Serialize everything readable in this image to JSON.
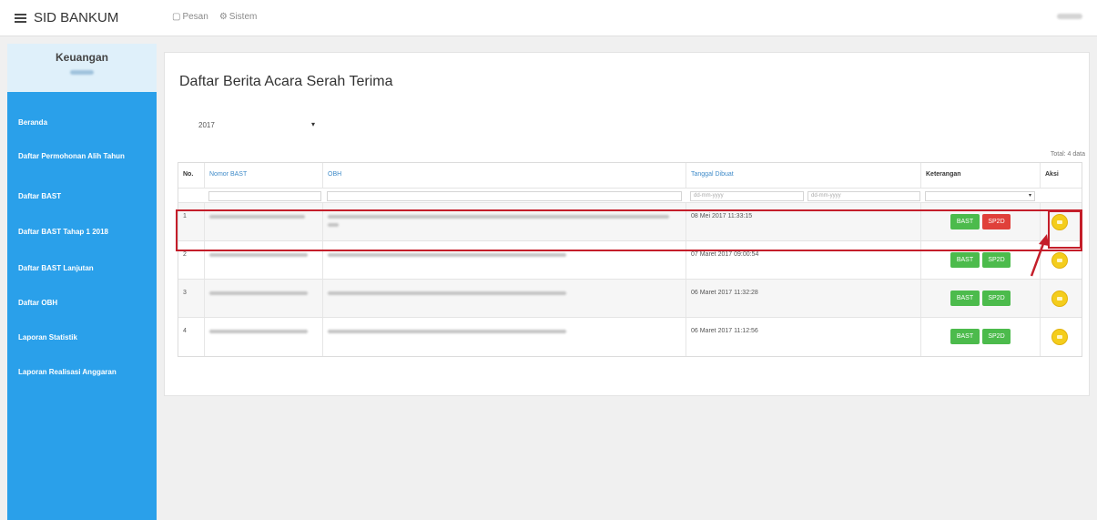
{
  "app": {
    "brand": "SID BANKUM"
  },
  "topnav": {
    "items": [
      {
        "icon": "message-icon",
        "label": "Pesan"
      },
      {
        "icon": "gear-icon",
        "label": "Sistem"
      }
    ]
  },
  "sidebar": {
    "header": {
      "title": "Keuangan"
    },
    "items": [
      {
        "label": "Beranda"
      },
      {
        "label": "Daftar Permohonan Alih Tahun"
      },
      {
        "label": "Daftar BAST"
      },
      {
        "label": "Daftar BAST Tahap 1 2018"
      },
      {
        "label": "Daftar BAST Lanjutan"
      },
      {
        "label": "Daftar OBH"
      },
      {
        "label": "Laporan Statistik"
      },
      {
        "label": "Laporan Realisasi Anggaran"
      }
    ]
  },
  "main": {
    "title": "Daftar Berita Acara Serah Terima",
    "year_select": {
      "value": "2017"
    },
    "total": "Total: 4 data",
    "table": {
      "headers": [
        "No.",
        "Nomor BAST",
        "OBH",
        "Tanggal Dibuat",
        "Keterangan",
        "Aksi"
      ],
      "filters": {
        "date_from_placeholder": "dd-mm-yyyy",
        "date_to_placeholder": "dd-mm-yyyy"
      },
      "rows": [
        {
          "no": "1",
          "tanggal": "08 Mei 2017 11:33:15",
          "badges": [
            "BAST",
            "SP2D"
          ]
        },
        {
          "no": "2",
          "tanggal": "07 Maret 2017 09:00:54",
          "badges": [
            "BAST",
            "SP2D"
          ]
        },
        {
          "no": "3",
          "tanggal": "06 Maret 2017 11:32:28",
          "badges": [
            "BAST",
            "SP2D"
          ]
        },
        {
          "no": "4",
          "tanggal": "06 Maret 2017 11:12:56",
          "badges": [
            "BAST",
            "SP2D"
          ]
        }
      ]
    }
  },
  "colors": {
    "sidebar": "#2aa0ea",
    "bast_badge": "#4cbb4c",
    "sp2d_badge_highlight": "#e0403a",
    "action_button": "#f4cd1c",
    "highlight": "#c41e2a"
  }
}
